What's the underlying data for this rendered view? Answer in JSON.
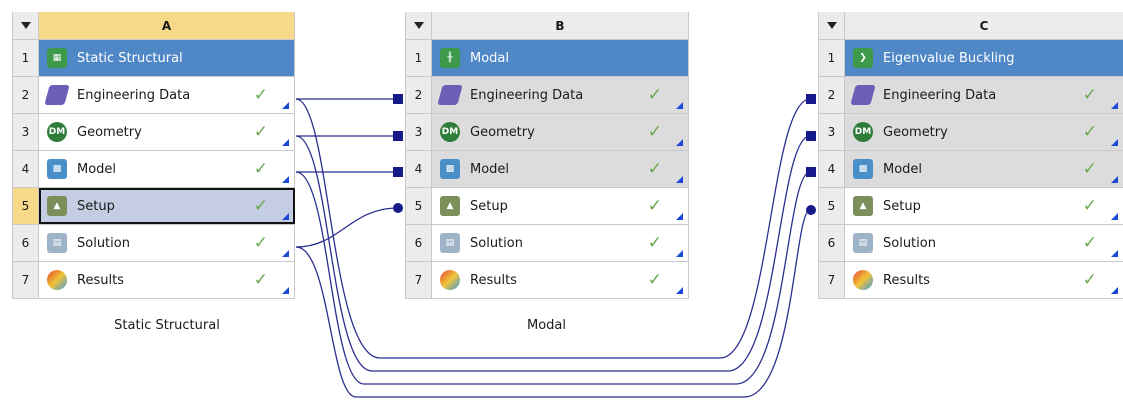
{
  "systems": [
    {
      "letter": "A",
      "caption": "Static Structural",
      "rows": [
        {
          "num": "1",
          "label": "Static Structural",
          "icon": "static-structural-icon"
        },
        {
          "num": "2",
          "label": "Engineering Data",
          "icon": "engineering-data-icon"
        },
        {
          "num": "3",
          "label": "Geometry",
          "icon": "geometry-dm-icon"
        },
        {
          "num": "4",
          "label": "Model",
          "icon": "model-icon"
        },
        {
          "num": "5",
          "label": "Setup",
          "icon": "setup-icon"
        },
        {
          "num": "6",
          "label": "Solution",
          "icon": "solution-icon"
        },
        {
          "num": "7",
          "label": "Results",
          "icon": "results-icon"
        }
      ]
    },
    {
      "letter": "B",
      "caption": "Modal",
      "rows": [
        {
          "num": "1",
          "label": "Modal",
          "icon": "modal-icon"
        },
        {
          "num": "2",
          "label": "Engineering Data",
          "icon": "engineering-data-icon"
        },
        {
          "num": "3",
          "label": "Geometry",
          "icon": "geometry-dm-icon"
        },
        {
          "num": "4",
          "label": "Model",
          "icon": "model-icon"
        },
        {
          "num": "5",
          "label": "Setup",
          "icon": "setup-icon"
        },
        {
          "num": "6",
          "label": "Solution",
          "icon": "solution-icon"
        },
        {
          "num": "7",
          "label": "Results",
          "icon": "results-icon"
        }
      ]
    },
    {
      "letter": "C",
      "caption": "",
      "rows": [
        {
          "num": "1",
          "label": "Eigenvalue Buckling",
          "icon": "eigenvalue-buckling-icon"
        },
        {
          "num": "2",
          "label": "Engineering Data",
          "icon": "engineering-data-icon"
        },
        {
          "num": "3",
          "label": "Geometry",
          "icon": "geometry-dm-icon"
        },
        {
          "num": "4",
          "label": "Model",
          "icon": "model-icon"
        },
        {
          "num": "5",
          "label": "Setup",
          "icon": "setup-icon"
        },
        {
          "num": "6",
          "label": "Solution",
          "icon": "solution-icon"
        },
        {
          "num": "7",
          "label": "Results",
          "icon": "results-icon"
        }
      ]
    }
  ],
  "icon_glyphs": {
    "geometry": "DM"
  },
  "colors": {
    "title_bar": "#4f87c7",
    "active_header": "#f8d98a",
    "connector": "#2a2f8f",
    "check": "#6aa84f",
    "corner": "#1d49d8"
  }
}
